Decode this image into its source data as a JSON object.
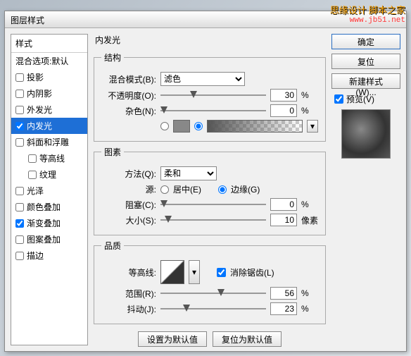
{
  "watermark": {
    "line1": "思缘设计 脚本之家",
    "line2": "www.jb51.net"
  },
  "dialog_title": "图层样式",
  "styles_header": "样式",
  "styles": [
    {
      "label": "混合选项:默认",
      "cb": false,
      "noCheckbox": true
    },
    {
      "label": "投影",
      "cb": false
    },
    {
      "label": "内阴影",
      "cb": false
    },
    {
      "label": "外发光",
      "cb": false
    },
    {
      "label": "内发光",
      "cb": true,
      "selected": true
    },
    {
      "label": "斜面和浮雕",
      "cb": false
    },
    {
      "label": "等高线",
      "cb": false,
      "indent": true
    },
    {
      "label": "纹理",
      "cb": false,
      "indent": true
    },
    {
      "label": "光泽",
      "cb": false
    },
    {
      "label": "颜色叠加",
      "cb": false
    },
    {
      "label": "渐变叠加",
      "cb": true
    },
    {
      "label": "图案叠加",
      "cb": false
    },
    {
      "label": "描边",
      "cb": false
    }
  ],
  "section_title": "内发光",
  "grp_structure": "结构",
  "blend_label": "混合模式(B):",
  "blend_value": "滤色",
  "opacity_label": "不透明度(O):",
  "opacity_value": "30",
  "noise_label": "杂色(N):",
  "noise_value": "0",
  "percent": "%",
  "grp_element": "图素",
  "method_label": "方法(Q):",
  "method_value": "柔和",
  "source_label": "源:",
  "source_center": "居中(E)",
  "source_edge": "边缘(G)",
  "choke_label": "阻塞(C):",
  "choke_value": "0",
  "size_label": "大小(S):",
  "size_value": "10",
  "pixels": "像素",
  "grp_quality": "品质",
  "contour_label": "等高线:",
  "antialias_label": "消除锯齿(L)",
  "range_label": "范围(R):",
  "range_value": "56",
  "jitter_label": "抖动(J):",
  "jitter_value": "23",
  "btn_make_default": "设置为默认值",
  "btn_reset_default": "复位为默认值",
  "btn_ok": "确定",
  "btn_cancel": "复位",
  "btn_new_style": "新建样式(W)...",
  "preview_label": "预览(V)"
}
